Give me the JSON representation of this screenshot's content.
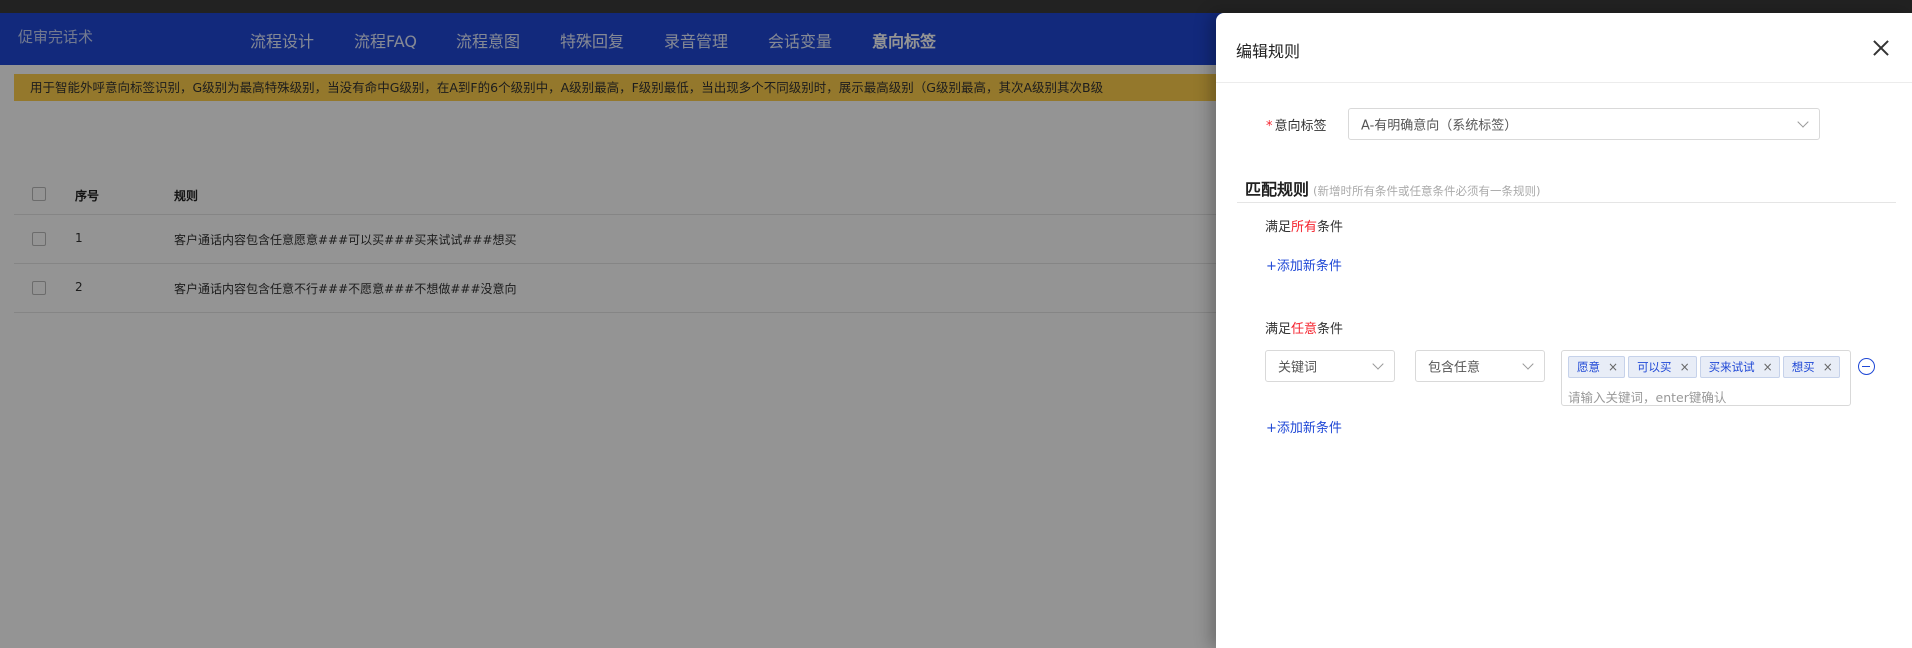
{
  "nav": {
    "brand": "促审完话术",
    "items": [
      "流程设计",
      "流程FAQ",
      "流程意图",
      "特殊回复",
      "录音管理",
      "会话变量",
      "意向标签"
    ],
    "active_index": 6
  },
  "notice": "用于智能外呼意向标签识别，G级别为最高特殊级别，当没有命中G级别，在A到F的6个级别中，A级别最高，F级别最低，当出现多个不同级别时，展示最高级别（G级别最高，其次A级别其次B级",
  "table": {
    "headers": [
      "序号",
      "规则"
    ],
    "rows": [
      {
        "no": "1",
        "rule": "客户通话内容包含任意愿意###可以买###买来试试###想买"
      },
      {
        "no": "2",
        "rule": "客户通话内容包含任意不行###不愿意###不想做###没意向"
      }
    ]
  },
  "drawer": {
    "title": "编辑规则",
    "tag_label": "意向标签",
    "tag_required_mark": "*",
    "tag_value": "A-有明确意向（系统标签）",
    "section_title": "匹配规则",
    "section_hint": "(新增时所有条件或任意条件必须有一条规则)",
    "all_group": {
      "prefix": "满足",
      "emphasis": "所有",
      "suffix": "条件",
      "add_label": "+添加新条件"
    },
    "any_group": {
      "prefix": "满足",
      "emphasis": "任意",
      "suffix": "条件",
      "add_label": "+添加新条件",
      "condition": {
        "field": "关键词",
        "operator": "包含任意",
        "keywords": [
          "愿意",
          "可以买",
          "买来试试",
          "想买"
        ],
        "placeholder": "请输入关键词，enter键确认"
      }
    }
  },
  "colors": {
    "nav": "#1f48d6",
    "notice": "#ffcf4d",
    "link": "#1f48d6",
    "required": "#f5222d"
  }
}
